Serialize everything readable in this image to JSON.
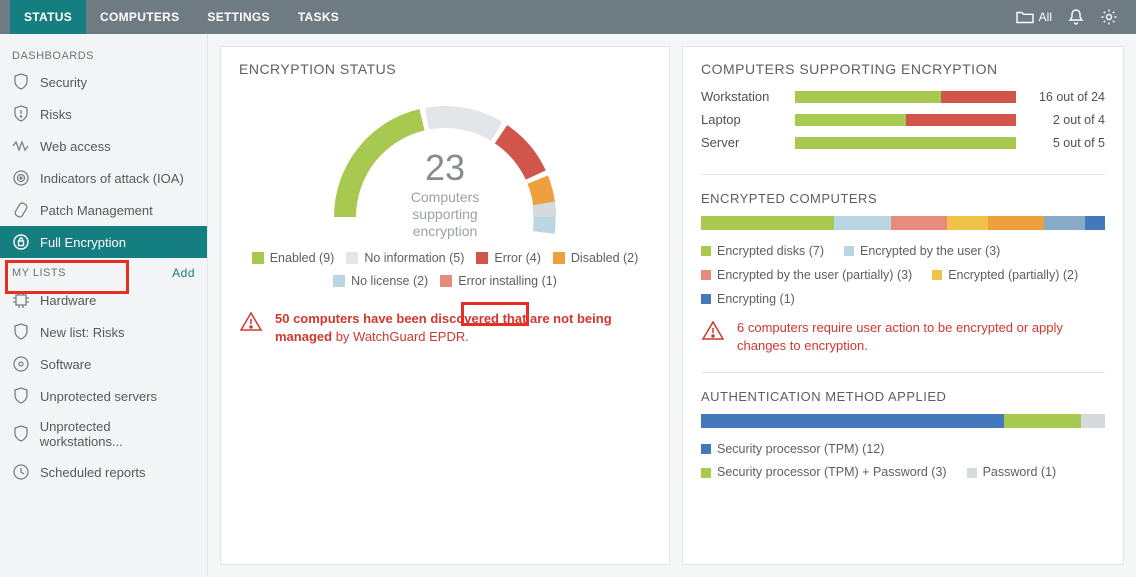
{
  "topbar": {
    "tabs": [
      "STATUS",
      "COMPUTERS",
      "SETTINGS",
      "TASKS"
    ],
    "all_label": "All"
  },
  "sidebar": {
    "dashboards_header": "DASHBOARDS",
    "dashboards": [
      {
        "label": "Security",
        "icon": "shield"
      },
      {
        "label": "Risks",
        "icon": "shield-alert"
      },
      {
        "label": "Web access",
        "icon": "wave"
      },
      {
        "label": "Indicators of attack (IOA)",
        "icon": "target"
      },
      {
        "label": "Patch Management",
        "icon": "patch"
      },
      {
        "label": "Full Encryption",
        "icon": "lock-cycle"
      }
    ],
    "mylists_header": "MY LISTS",
    "add_label": "Add",
    "mylists": [
      {
        "label": "Hardware",
        "icon": "chip"
      },
      {
        "label": "New list: Risks",
        "icon": "shield-plain"
      },
      {
        "label": "Software",
        "icon": "disc"
      },
      {
        "label": "Unprotected servers",
        "icon": "shield-plain"
      },
      {
        "label": "Unprotected workstations...",
        "icon": "shield-plain"
      },
      {
        "label": "Scheduled reports",
        "icon": "clock"
      }
    ]
  },
  "encryption_status": {
    "title": "ENCRYPTION STATUS",
    "count": "23",
    "sub1": "Computers",
    "sub2": "supporting",
    "sub3": "encryption",
    "legend": [
      {
        "label": "Enabled (9)",
        "color": "#a8c94f"
      },
      {
        "label": "No information (5)",
        "color": "#e3e6e8"
      },
      {
        "label": "Error (4)",
        "color": "#d0564c"
      },
      {
        "label": "Disabled (2)",
        "color": "#ee9f3e"
      },
      {
        "label": "No license (2)",
        "color": "#b9d7e2"
      },
      {
        "label": "Error installing (1)",
        "color": "#e78b7c"
      }
    ],
    "alertA": "50 computers have been discovered that are not being managed",
    "alertA_trail": " by WatchGuard EPDR."
  },
  "supporting": {
    "title": "COMPUTERS SUPPORTING ENCRYPTION",
    "rows": [
      {
        "name": "Workstation",
        "green": 66,
        "red": 34,
        "val": "16 out of 24"
      },
      {
        "name": "Laptop",
        "green": 50,
        "red": 50,
        "val": "2 out of 4"
      },
      {
        "name": "Server",
        "green": 100,
        "red": 0,
        "val": "5 out of 5"
      }
    ]
  },
  "encrypted": {
    "title": "ENCRYPTED COMPUTERS",
    "segments": [
      {
        "color": "#a8c94f",
        "pct": 33
      },
      {
        "color": "#b9d7e2",
        "pct": 14
      },
      {
        "color": "#e78b7c",
        "pct": 14
      },
      {
        "color": "#f0c24a",
        "pct": 10
      },
      {
        "color": "#ee9f3e",
        "pct": 14
      },
      {
        "color": "#88a9c8",
        "pct": 10
      },
      {
        "color": "#4478bd",
        "pct": 5
      }
    ],
    "legend": [
      {
        "label": "Encrypted disks (7)",
        "color": "#a8c94f"
      },
      {
        "label": "Encrypted by the user (3)",
        "color": "#b9d7e2"
      },
      {
        "label": "Encrypted by the user (partially) (3)",
        "color": "#e78b7c"
      },
      {
        "label": "Encrypted (partially) (2)",
        "color": "#f0c24a"
      },
      {
        "label": "Encrypting (1)",
        "color": "#4478bd"
      }
    ],
    "alert": "6 computers require user action to be encrypted or apply changes to encryption."
  },
  "auth": {
    "title": "AUTHENTICATION METHOD APPLIED",
    "segments": [
      {
        "color": "#4478bd",
        "pct": 75
      },
      {
        "color": "#a8c94f",
        "pct": 19
      },
      {
        "color": "#d7dadd",
        "pct": 6
      }
    ],
    "legend": [
      {
        "label": "Security processor (TPM) (12)",
        "color": "#4478bd"
      },
      {
        "label": "Security processor (TPM) + Password (3)",
        "color": "#a8c94f"
      },
      {
        "label": "Password (1)",
        "color": "#d7dadd"
      }
    ]
  },
  "chart_data": {
    "type": "pie",
    "title": "Encryption Status",
    "categories": [
      "Enabled",
      "No information",
      "Error",
      "Disabled",
      "No license",
      "Error installing"
    ],
    "values": [
      9,
      5,
      4,
      2,
      2,
      1
    ],
    "total": 23
  }
}
